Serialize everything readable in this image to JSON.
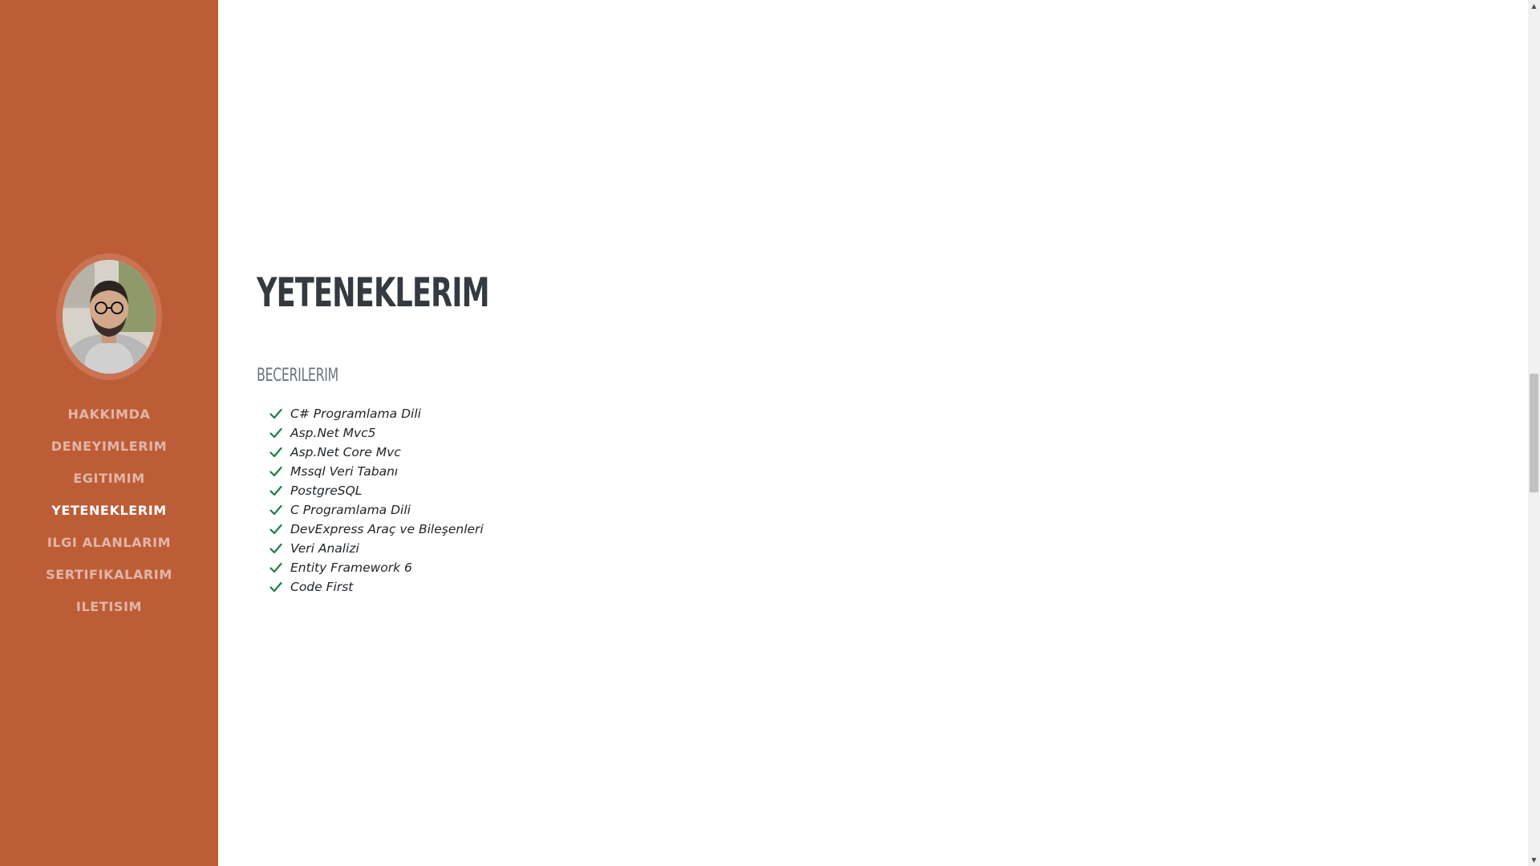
{
  "sidebar": {
    "avatar_alt": "",
    "nav": [
      {
        "label": "HAKKIMDA",
        "active": false
      },
      {
        "label": "DENEYIMLERIM",
        "active": false
      },
      {
        "label": "EGITIMIM",
        "active": false
      },
      {
        "label": "YETENEKLERIM",
        "active": true
      },
      {
        "label": "ILGI ALANLARIM",
        "active": false
      },
      {
        "label": "SERTIFIKALARIM",
        "active": false
      },
      {
        "label": "ILETISIM",
        "active": false
      }
    ]
  },
  "main": {
    "section_title": "YETENEKLERIM",
    "subsection_title": "BECERILERIM",
    "skills": [
      "C# Programlama Dili",
      "Asp.Net Mvc5",
      "Asp.Net Core Mvc",
      "Mssql Veri Tabanı",
      "PostgreSQL",
      "C Programlama Dili",
      "DevExpress Araç ve Bileşenleri",
      "Veri Analizi",
      "Entity Framework 6",
      "Code First"
    ]
  },
  "colors": {
    "sidebar_bg": "#bd5d38",
    "check_color": "#1e7e4a",
    "title_color": "#343a40",
    "subtitle_color": "#6c757d"
  },
  "icons": {
    "check": "check-icon",
    "scroll_up": "chevron-up-icon",
    "scroll_down": "chevron-down-icon"
  }
}
